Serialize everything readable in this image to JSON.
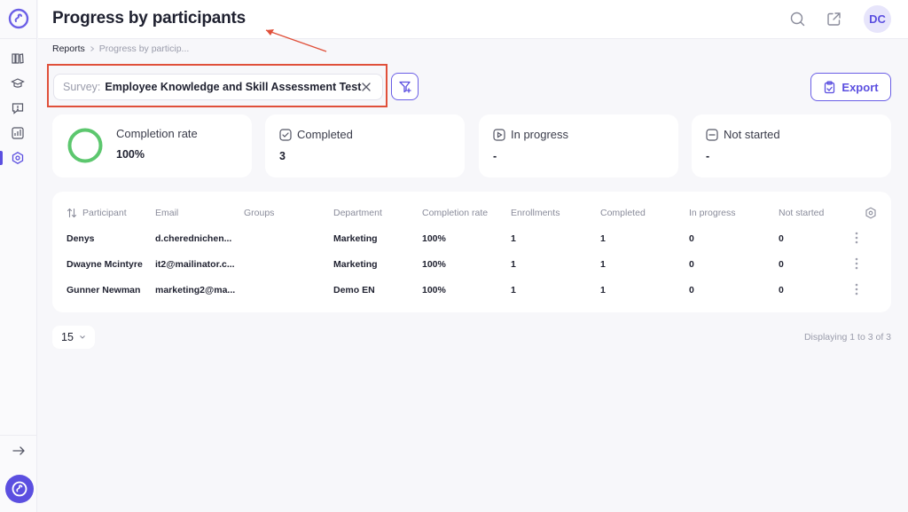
{
  "header": {
    "title": "Progress by participants",
    "avatar_initials": "DC"
  },
  "breadcrumb": {
    "root": "Reports",
    "current": "Progress by particip..."
  },
  "filter": {
    "label": "Survey:",
    "value": "Employee Knowledge and Skill Assessment Test"
  },
  "export_label": "Export",
  "stats": {
    "completion_rate": {
      "title": "Completion rate",
      "value": "100%",
      "ring_fraction": 1.0
    },
    "completed": {
      "title": "Completed",
      "value": "3"
    },
    "in_progress": {
      "title": "In progress",
      "value": "-"
    },
    "not_started": {
      "title": "Not started",
      "value": "-"
    }
  },
  "table": {
    "columns": [
      "Participant",
      "Email",
      "Groups",
      "Department",
      "Completion rate",
      "Enrollments",
      "Completed",
      "In progress",
      "Not started"
    ],
    "rows": [
      [
        "Denys",
        "d.cherednichen...",
        "",
        "Marketing",
        "100%",
        "1",
        "1",
        "0",
        "0"
      ],
      [
        "Dwayne Mcintyre",
        "it2@mailinator.c...",
        "",
        "Marketing",
        "100%",
        "1",
        "1",
        "0",
        "0"
      ],
      [
        "Gunner Newman",
        "marketing2@ma...",
        "",
        "Demo EN",
        "100%",
        "1",
        "1",
        "0",
        "0"
      ]
    ]
  },
  "pagination": {
    "per_page": "15",
    "displaying": "Displaying 1 to 3 of 3"
  },
  "colors": {
    "accent": "#5b4fe0",
    "ring": "#5cc76e",
    "annotation": "#e0503a"
  }
}
